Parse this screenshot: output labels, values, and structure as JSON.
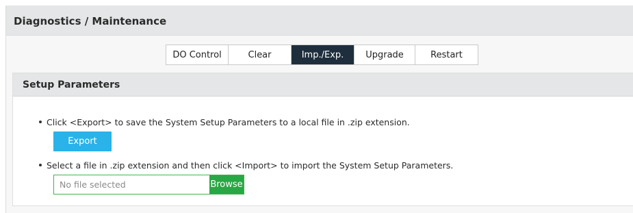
{
  "header": {
    "title": "Diagnostics / Maintenance"
  },
  "tabs": [
    {
      "label": "DO Control",
      "active": false
    },
    {
      "label": "Clear",
      "active": false
    },
    {
      "label": "Imp./Exp.",
      "active": true
    },
    {
      "label": "Upgrade",
      "active": false
    },
    {
      "label": "Restart",
      "active": false
    }
  ],
  "panel": {
    "title": "Setup Parameters",
    "export_instruction": "Click <Export> to save the System Setup Parameters to a local file in .zip extension.",
    "export_button": "Export",
    "import_instruction": "Select a file in .zip extension and then click <Import> to import the System Setup Parameters.",
    "file_placeholder": "No file selected",
    "browse_button": "Browse"
  },
  "colors": {
    "active_tab_bg": "#1e2e3c",
    "export_button_bg": "#29b3e8",
    "browse_button_bg": "#28a745",
    "file_field_border": "#46b14e"
  }
}
